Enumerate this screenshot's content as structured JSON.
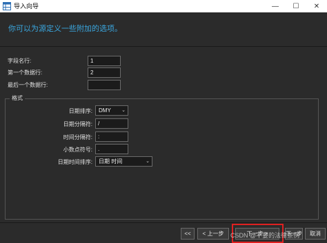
{
  "window": {
    "title": "导入向导",
    "minimize_glyph": "—",
    "maximize_glyph": "☐",
    "close_glyph": "✕"
  },
  "header": {
    "subtitle": "你可以为源定义一些附加的选项。"
  },
  "fields": {
    "field_name_row": {
      "label": "字段名行:",
      "value": "1"
    },
    "first_data_row": {
      "label": "第一个数据行:",
      "value": "2"
    },
    "last_data_row": {
      "label": "最后一个数据行:",
      "value": ""
    }
  },
  "format_group": {
    "label": "格式",
    "date_order": {
      "label": "日期排序:",
      "value": "DMY"
    },
    "date_separator": {
      "label": "日期分隔符:",
      "value": "/"
    },
    "time_separator": {
      "label": "时间分隔符:",
      "value": ":"
    },
    "decimal_symbol": {
      "label": "小数点符号:",
      "value": "."
    },
    "datetime_order": {
      "label": "日期时间排序:",
      "value": "日期 时间"
    }
  },
  "buttons": {
    "first": "<<",
    "prev": "< 上一步",
    "next": "下一步 >",
    "next_partial": "下一步",
    "cancel": "取消"
  },
  "watermark": "CSDN @不要的法律条例",
  "colors": {
    "accent": "#3aa6de",
    "highlight_box": "#e02020",
    "background": "#2b2b2b"
  }
}
